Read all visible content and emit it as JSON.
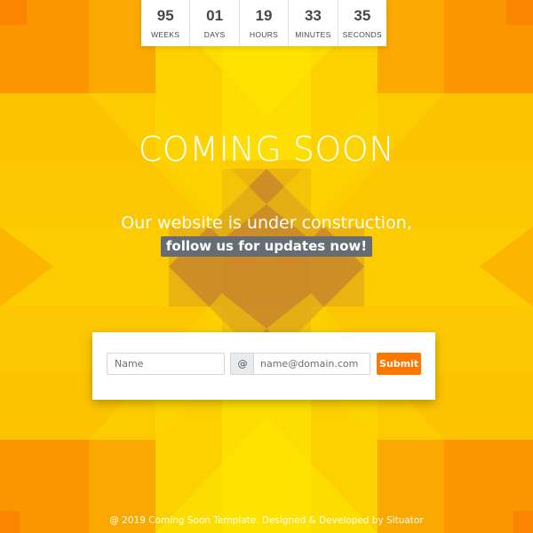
{
  "colors": {
    "accent": "#fc7600",
    "background": "#fcc400",
    "highlight_bg": "#666c73"
  },
  "countdown": [
    {
      "value": "95",
      "label": "WEEKS"
    },
    {
      "value": "01",
      "label": "DAYS"
    },
    {
      "value": "19",
      "label": "HOURS"
    },
    {
      "value": "33",
      "label": "MINUTES"
    },
    {
      "value": "35",
      "label": "SECONDS"
    }
  ],
  "hero": {
    "title": "COMING SOON",
    "subtitle": "Our website is under construction,",
    "highlight": "follow us for updates now!"
  },
  "form": {
    "name_placeholder": "Name",
    "name_value": "",
    "at_symbol": "@",
    "email_placeholder": "name@domain.com",
    "email_value": "",
    "submit_label": "Submit"
  },
  "footer": {
    "text": "@ 2019 Coming Soon Template. Designed & Developed by Situator"
  }
}
